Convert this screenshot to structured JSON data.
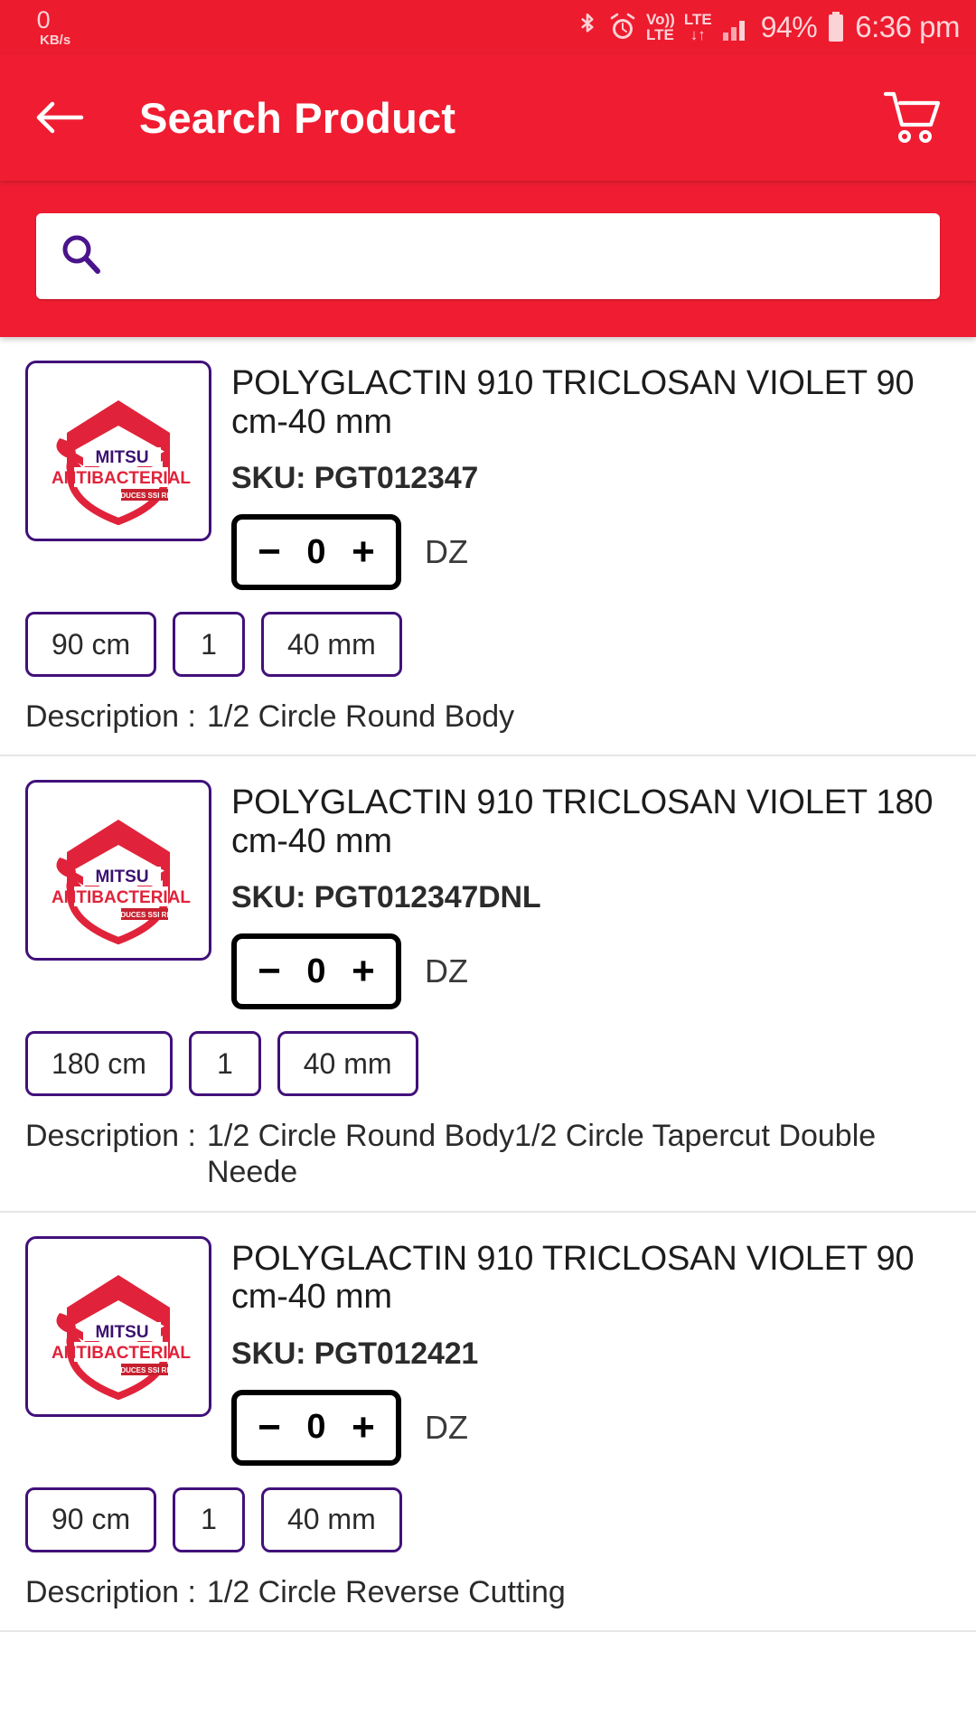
{
  "statusbar": {
    "net_speed_value": "0",
    "net_speed_unit": "KB/s",
    "bluetooth_icon": "bluetooth-icon",
    "alarm_icon": "alarm-icon",
    "volte_top": "Vo))",
    "volte_bottom": "LTE",
    "lte_top": "LTE",
    "lte_bottom": "↓↑",
    "signal_icon": "signal-bars-icon",
    "battery_percent": "94%",
    "battery_icon": "battery-icon",
    "time": "6:36 pm"
  },
  "appbar": {
    "back_icon": "back-arrow-icon",
    "title": "Search Product",
    "cart_icon": "shopping-cart-icon"
  },
  "search": {
    "icon": "search-icon",
    "value": "",
    "placeholder": ""
  },
  "colors": {
    "brand_red": "#f01d32",
    "status_red": "#ed1b2e",
    "accent_purple": "#41107a",
    "stepper_black": "#000000"
  },
  "labels": {
    "sku_label": "SKU:",
    "description_label": "Description :",
    "minus": "−",
    "plus": "+"
  },
  "products": [
    {
      "title": "POLYGLACTIN 910 TRICLOSAN VIOLET 90 cm-40 mm",
      "sku": "PGT012347",
      "quantity": "0",
      "unit": "DZ",
      "chips": [
        "90 cm",
        "1",
        "40 mm"
      ],
      "description": "1/2 Circle Round Body",
      "thumb_brand_top": "MITSU",
      "thumb_brand_main": "ANTIBACTERIAL",
      "thumb_brand_sub": "REDUCES SSI RISK"
    },
    {
      "title": "POLYGLACTIN 910 TRICLOSAN VIOLET 180 cm-40 mm",
      "sku": "PGT012347DNL",
      "quantity": "0",
      "unit": "DZ",
      "chips": [
        "180 cm",
        "1",
        "40 mm"
      ],
      "description": "1/2 Circle Round Body1/2 Circle Tapercut Double Neede",
      "thumb_brand_top": "MITSU",
      "thumb_brand_main": "ANTIBACTERIAL",
      "thumb_brand_sub": "REDUCES SSI RISK"
    },
    {
      "title": "POLYGLACTIN 910 TRICLOSAN VIOLET 90 cm-40 mm",
      "sku": "PGT012421",
      "quantity": "0",
      "unit": "DZ",
      "chips": [
        "90 cm",
        "1",
        "40 mm"
      ],
      "description": "1/2 Circle Reverse Cutting",
      "thumb_brand_top": "MITSU",
      "thumb_brand_main": "ANTIBACTERIAL",
      "thumb_brand_sub": "REDUCES SSI RISK"
    }
  ]
}
